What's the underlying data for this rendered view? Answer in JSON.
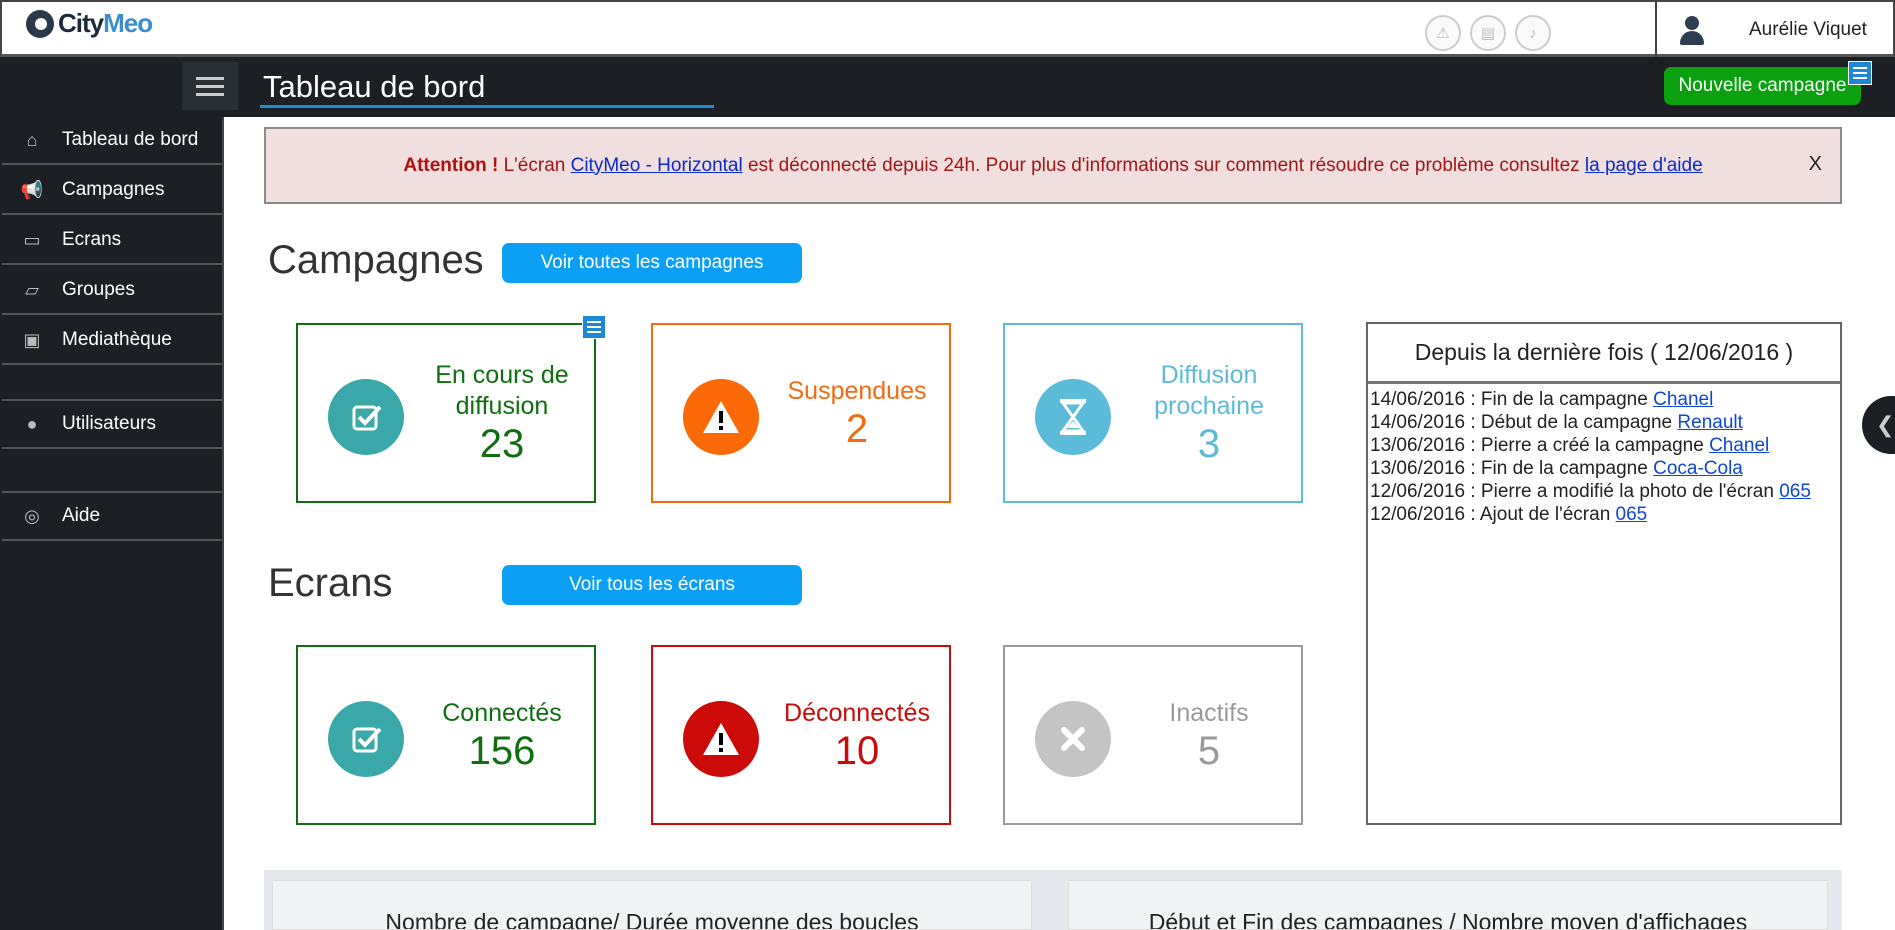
{
  "app": {
    "logo_part1": "City",
    "logo_part2": "Meo"
  },
  "topbar": {
    "icons": [
      "warning-icon",
      "message-icon",
      "bell-icon"
    ],
    "user_name": "Aurélie Viquet"
  },
  "header": {
    "title": "Tableau de bord",
    "new_campaign_label": "Nouvelle campagne"
  },
  "sidebar": {
    "items": [
      {
        "label": "Tableau de bord",
        "icon": "home-icon"
      },
      {
        "label": "Campagnes",
        "icon": "megaphone-icon"
      },
      {
        "label": "Ecrans",
        "icon": "monitor-icon"
      },
      {
        "label": "Groupes",
        "icon": "folder-icon"
      },
      {
        "label": "Mediathèque",
        "icon": "image-icon"
      },
      {
        "label": "Utilisateurs",
        "icon": "user-icon"
      },
      {
        "label": "Aide",
        "icon": "lifebuoy-icon"
      }
    ]
  },
  "alert": {
    "strong": "Attention !",
    "text1": " L'écran ",
    "link1": "CityMeo - Horizontal",
    "text2": " est déconnecté depuis 24h. Pour plus d'informations sur comment résoudre ce problème consultez ",
    "link2": "la page d'aide",
    "close": "X"
  },
  "campaigns": {
    "title": "Campagnes",
    "button": "Voir toutes les campagnes",
    "cards": [
      {
        "label": "En cours de diffusion",
        "value": "23",
        "color": "#0f6e10",
        "icon": "check-icon",
        "icon_bg": "#3aa8a8"
      },
      {
        "label": "Suspendues",
        "value": "2",
        "color": "#f26b0f",
        "icon": "warning-icon",
        "icon_bg": "#fb6a07"
      },
      {
        "label": "Diffusion prochaine",
        "value": "3",
        "color": "#5bbbd9",
        "icon": "hourglass-icon",
        "icon_bg": "#5bbbd9"
      }
    ]
  },
  "screens": {
    "title": "Ecrans",
    "button": "Voir tous les écrans",
    "cards": [
      {
        "label": "Connectés",
        "value": "156",
        "color": "#0f6e10",
        "icon": "check-icon",
        "icon_bg": "#3aa8a8"
      },
      {
        "label": "Déconnectés",
        "value": "10",
        "color": "#cc0a0a",
        "icon": "warning-icon",
        "icon_bg": "#cc0a0a"
      },
      {
        "label": "Inactifs",
        "value": "5",
        "color": "#9a9a9a",
        "icon": "close-icon",
        "icon_bg": "#c4c4c4"
      }
    ]
  },
  "recent": {
    "title": "Depuis la dernière fois ( 12/06/2016 )",
    "items": [
      {
        "text": "14/06/2016 : Fin de la campagne ",
        "link": "Chanel"
      },
      {
        "text": "14/06/2016 : Début de la campagne ",
        "link": "Renault"
      },
      {
        "text": "13/06/2016 : Pierre a créé la campagne ",
        "link": "Chanel"
      },
      {
        "text": "13/06/2016 : Fin de la campagne ",
        "link": "Coca-Cola"
      },
      {
        "text": "12/06/2016 : Pierre a modifié la photo de l'écran ",
        "link": "065"
      },
      {
        "text": "12/06/2016 : Ajout de l'écran ",
        "link": "065"
      }
    ]
  },
  "charts": {
    "left_title": "Nombre de campagne/ Durée moyenne des boucles",
    "right_title": "Début et Fin des campagnes / Nombre moyen d'affichages"
  }
}
